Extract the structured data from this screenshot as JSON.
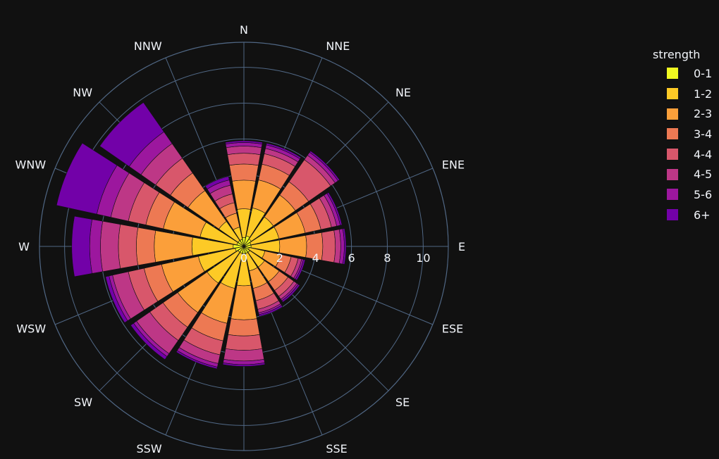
{
  "chart_data": {
    "type": "barpolar",
    "directions": [
      "N",
      "NNE",
      "NE",
      "ENE",
      "E",
      "ESE",
      "SE",
      "SSE",
      "S",
      "SSW",
      "SW",
      "WSW",
      "W",
      "WNW",
      "NW",
      "NNW"
    ],
    "radial_ticks": [
      "0",
      "2",
      "4",
      "6",
      "8",
      "10"
    ],
    "radial_range": [
      0,
      11.4
    ],
    "legend_title": "strength",
    "series": [
      {
        "name": "0-1",
        "color": "#f0f921",
        "values": [
          0.5,
          0.6,
          0.5,
          0.4,
          0.4,
          0.3,
          0.4,
          0.4,
          0.4,
          0.4,
          0.4,
          0.5,
          0.6,
          0.4,
          0.4,
          0.4
        ]
      },
      {
        "name": "1-2",
        "color": "#fdca26",
        "values": [
          1.6,
          1.6,
          1.5,
          1.6,
          1.6,
          0.9,
          1.0,
          1.0,
          1.8,
          2.0,
          2.1,
          2.1,
          2.3,
          2.1,
          1.3,
          0.7
        ]
      },
      {
        "name": "2-3",
        "color": "#fb9f3a",
        "values": [
          1.6,
          1.6,
          1.5,
          1.5,
          1.5,
          0.9,
          1.0,
          1.0,
          1.9,
          2.0,
          2.0,
          2.1,
          2.1,
          2.1,
          2.1,
          0.8
        ]
      },
      {
        "name": "3-4",
        "color": "#ed7953",
        "values": [
          0.9,
          0.9,
          0.9,
          0.9,
          0.9,
          0.6,
          0.6,
          0.7,
          0.9,
          1.0,
          1.0,
          1.0,
          1.0,
          1.0,
          1.2,
          0.6
        ]
      },
      {
        "name": "4-4",
        "color": "#d8576b",
        "values": [
          0.6,
          0.6,
          1.5,
          0.6,
          0.7,
          0.4,
          0.4,
          0.5,
          0.8,
          0.8,
          0.9,
          0.9,
          1.0,
          1.0,
          1.0,
          0.5
        ]
      },
      {
        "name": "4-5",
        "color": "#bd3786",
        "values": [
          0.4,
          0.3,
          0.3,
          0.3,
          0.3,
          0.2,
          0.2,
          0.2,
          0.6,
          0.5,
          0.9,
          0.9,
          1.0,
          1.0,
          1.0,
          0.5
        ]
      },
      {
        "name": "5-6",
        "color": "#9c179e",
        "values": [
          0.2,
          0.2,
          0.2,
          0.2,
          0.2,
          0.1,
          0.1,
          0.1,
          0.2,
          0.2,
          0.2,
          0.2,
          0.6,
          0.8,
          0.8,
          0.3
        ]
      },
      {
        "name": "6+",
        "color": "#7201a8",
        "values": [
          0.1,
          0.1,
          0.1,
          0.1,
          0.1,
          0.1,
          0.1,
          0.1,
          0.1,
          0.1,
          0.2,
          0.2,
          1.0,
          2.3,
          2.0,
          0.2
        ]
      }
    ]
  }
}
